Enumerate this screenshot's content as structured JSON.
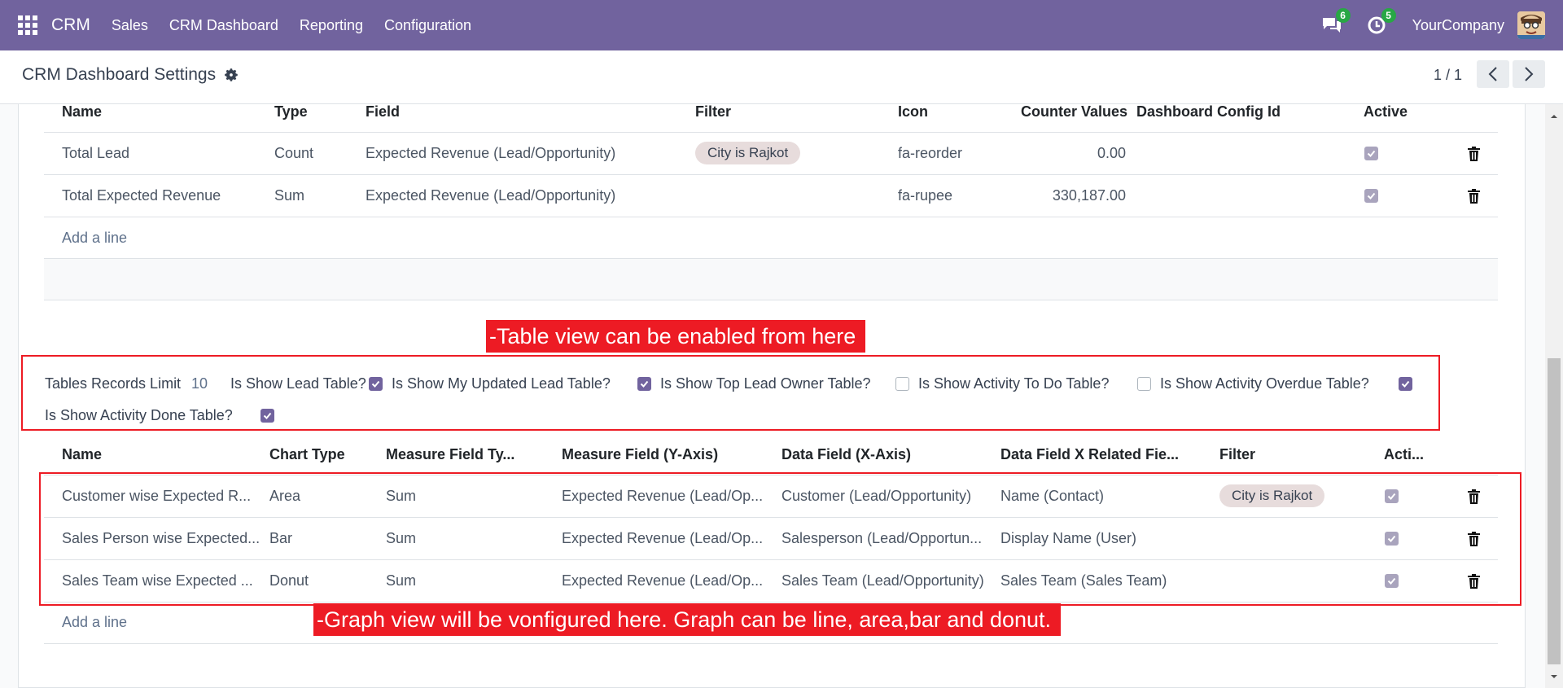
{
  "navbar": {
    "brand": "CRM",
    "menu": [
      "Sales",
      "CRM Dashboard",
      "Reporting",
      "Configuration"
    ],
    "messages_count": "6",
    "activities_count": "5",
    "company": "YourCompany",
    "color": "#71639e"
  },
  "control_panel": {
    "breadcrumb": "CRM Dashboard Settings",
    "pager": "1 / 1"
  },
  "counter_table": {
    "headers": [
      "Name",
      "Type",
      "Field",
      "Filter",
      "Icon",
      "Counter Values",
      "Dashboard Config Id",
      "Active"
    ],
    "rows": [
      {
        "name": "Total Lead",
        "type": "Count",
        "field": "Expected Revenue (Lead/Opportunity)",
        "filter": "City is Rajkot",
        "icon": "fa-reorder",
        "counter": "0.00",
        "active": true
      },
      {
        "name": "Total Expected Revenue",
        "type": "Sum",
        "field": "Expected Revenue (Lead/Opportunity)",
        "filter": "",
        "icon": "fa-rupee",
        "counter": "330,187.00",
        "active": true
      }
    ],
    "add_line": "Add a line"
  },
  "table_settings": {
    "limit_label": "Tables Records Limit",
    "limit_value": "10",
    "options": [
      {
        "label": "Is Show Lead Table?",
        "checked": true
      },
      {
        "label": "Is Show My Updated Lead Table?",
        "checked": true
      },
      {
        "label": "Is Show Top Lead Owner Table?",
        "checked": false
      },
      {
        "label": "Is Show Activity To Do Table?",
        "checked": false
      },
      {
        "label": "Is Show Activity Overdue Table?",
        "checked": true
      },
      {
        "label": "Is Show Activity Done Table?",
        "checked": true
      }
    ]
  },
  "chart_table": {
    "headers": [
      "Name",
      "Chart Type",
      "Measure Field Ty...",
      "Measure Field (Y-Axis)",
      "Data Field (X-Axis)",
      "Data Field X Related Fie...",
      "Filter",
      "Acti..."
    ],
    "rows": [
      {
        "name": "Customer wise Expected R...",
        "chart_type": "Area",
        "measure_type": "Sum",
        "measure_field": "Expected Revenue (Lead/Op...",
        "data_field": "Customer (Lead/Opportunity)",
        "related": "Name (Contact)",
        "filter": "City is Rajkot",
        "active": true
      },
      {
        "name": "Sales Person wise Expected...",
        "chart_type": "Bar",
        "measure_type": "Sum",
        "measure_field": "Expected Revenue (Lead/Op...",
        "data_field": "Salesperson (Lead/Opportun...",
        "related": "Display Name (User)",
        "filter": "",
        "active": true
      },
      {
        "name": "Sales Team wise Expected ...",
        "chart_type": "Donut",
        "measure_type": "Sum",
        "measure_field": "Expected Revenue (Lead/Op...",
        "data_field": "Sales Team (Lead/Opportunity)",
        "related": "Sales Team (Sales Team)",
        "filter": "",
        "active": true
      }
    ],
    "add_line": "Add a line"
  },
  "annotations": {
    "table_note": "-Table view can be enabled from here",
    "graph_note": "-Graph view will be vonfigured here. Graph can be line, area,bar and donut.",
    "color": "#ed1b24"
  }
}
